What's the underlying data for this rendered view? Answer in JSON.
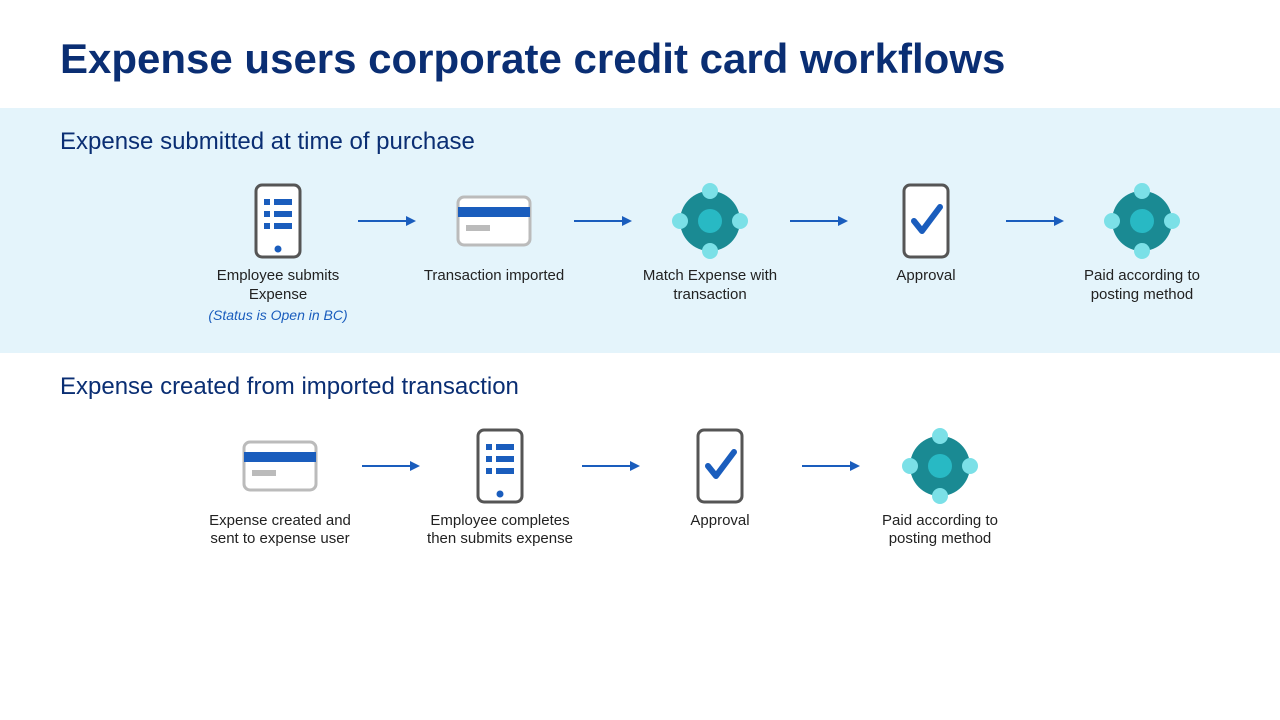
{
  "title": "Expense users corporate credit card workflows",
  "colors": {
    "heading": "#0a2e73",
    "arrow": "#1a5dbd",
    "iconStroke": "#1a5dbd",
    "iconFill": "#ffffff",
    "accentTeal": "#28b9c4",
    "accentTealDark": "#1a8a93",
    "accentTealLight": "#7be0e7",
    "sectionBg": "#e4f4fb"
  },
  "sections": [
    {
      "title": "Expense submitted at time of purchase",
      "background": true,
      "steps": [
        {
          "icon": "phone-list",
          "label": "Employee submits Expense",
          "sublabel": "(Status is Open in BC)"
        },
        {
          "icon": "card",
          "label": "Transaction imported"
        },
        {
          "icon": "hub",
          "label": "Match Expense with transaction"
        },
        {
          "icon": "phone-check",
          "label": "Approval"
        },
        {
          "icon": "hub",
          "label": "Paid according to posting method"
        }
      ]
    },
    {
      "title": "Expense created from imported transaction",
      "background": false,
      "steps": [
        {
          "icon": "card",
          "label": "Expense created and sent to expense user"
        },
        {
          "icon": "phone-list",
          "label": "Employee completes then submits expense"
        },
        {
          "icon": "phone-check",
          "label": "Approval"
        },
        {
          "icon": "hub",
          "label": "Paid according to posting method"
        }
      ]
    }
  ],
  "iconNames": {
    "phone-list": "phone-list-icon",
    "card": "card-icon",
    "hub": "hub-icon",
    "phone-check": "phone-check-icon",
    "arrow": "arrow-right-icon"
  }
}
